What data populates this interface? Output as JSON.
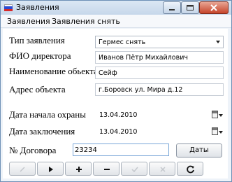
{
  "window": {
    "title": "Заявления"
  },
  "menu": {
    "items": [
      "Заявления",
      "Заявления снять"
    ]
  },
  "form": {
    "type": {
      "label": "Тип заявления",
      "value": "Гермес снять"
    },
    "director": {
      "label": "ФИО директора",
      "value": "Иванов Пётр Михайлович"
    },
    "object_name": {
      "label": "Наименование обьекта",
      "value": "Сейф"
    },
    "address": {
      "label": "Адрес объекта",
      "value": "г.Боровск ул. Мира  д.12"
    },
    "guard_start": {
      "label": "Дата начала охраны",
      "value": "13.04.2010"
    },
    "conclusion_date": {
      "label": "Дата заключения",
      "value": "13.04.2010"
    },
    "contract": {
      "label": "№ Договора",
      "value": "23234"
    },
    "dates_button": "Даты"
  },
  "navigator": {
    "buttons": [
      {
        "name": "edit",
        "enabled": false
      },
      {
        "name": "next",
        "enabled": true
      },
      {
        "name": "insert",
        "enabled": true
      },
      {
        "name": "delete",
        "enabled": true
      },
      {
        "name": "post",
        "enabled": false
      },
      {
        "name": "cancel",
        "enabled": false
      },
      {
        "name": "refresh",
        "enabled": true
      }
    ]
  },
  "colors": {
    "accent": "#7aa7d8",
    "close": "#c7452b"
  }
}
